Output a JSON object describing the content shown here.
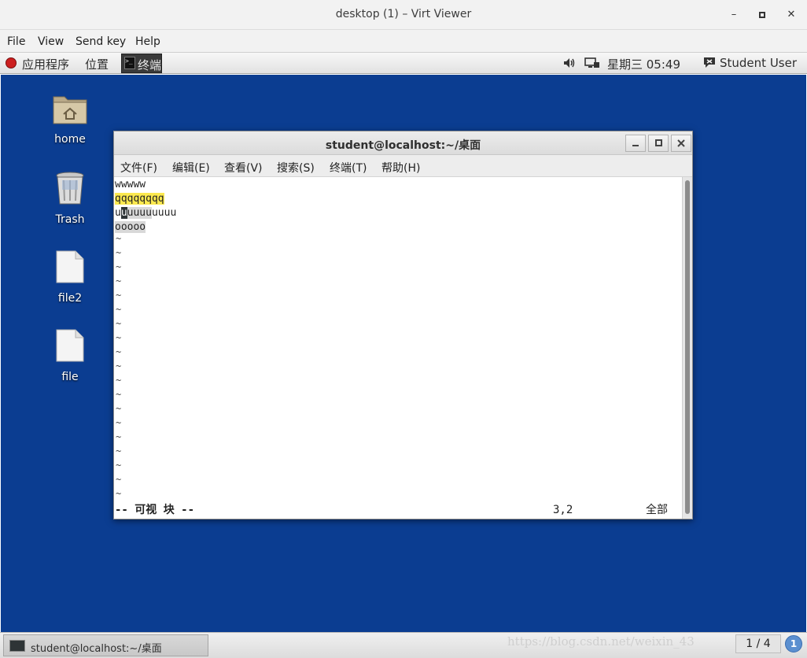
{
  "window": {
    "title": "desktop (1) – Virt Viewer",
    "minimize_glyph": "–",
    "maximize_glyph": "▫",
    "close_glyph": "✕"
  },
  "viewer_menu": [
    {
      "label": "File"
    },
    {
      "label": "View"
    },
    {
      "label": "Send key"
    },
    {
      "label": "Help"
    }
  ],
  "top_panel": {
    "applications_label": "应用程序",
    "places_label": "位置",
    "terminal_button_label": "终端",
    "clock": "星期三 05:49",
    "user": "Student User"
  },
  "desktop_icons": [
    {
      "label": "home",
      "icon": "home-folder-icon"
    },
    {
      "label": "Trash",
      "icon": "trash-icon"
    },
    {
      "label": "file2",
      "icon": "file-icon"
    },
    {
      "label": "file",
      "icon": "file-icon"
    }
  ],
  "terminal": {
    "title": "student@localhost:~/桌面",
    "menu": [
      {
        "label": "文件(F)"
      },
      {
        "label": "编辑(E)"
      },
      {
        "label": "查看(V)"
      },
      {
        "label": "搜索(S)"
      },
      {
        "label": "终端(T)"
      },
      {
        "label": "帮助(H)"
      }
    ],
    "lines": {
      "l1": "wwwww",
      "l2": "qqqqqqqq",
      "l3_pre": "u",
      "l3_cursor": "u",
      "l3_sel": "uuuu",
      "l3_post": "uuuu",
      "l4_sel": "ooooo"
    },
    "tilde": "~",
    "status_mode": "-- 可视 块 --",
    "status_position": "3,2",
    "status_all": "全部",
    "colors": {
      "highlight": "#fce94f",
      "selection": "#d8d8d8",
      "cursor": "#2e3436"
    }
  },
  "taskbar": {
    "task_label": "student@localhost:~/桌面",
    "watermark": "https://blog.csdn.net/weixin_43",
    "pager": "1 / 4",
    "notification_count": "1"
  },
  "colors": {
    "desktop_background": "#0b3d91"
  }
}
